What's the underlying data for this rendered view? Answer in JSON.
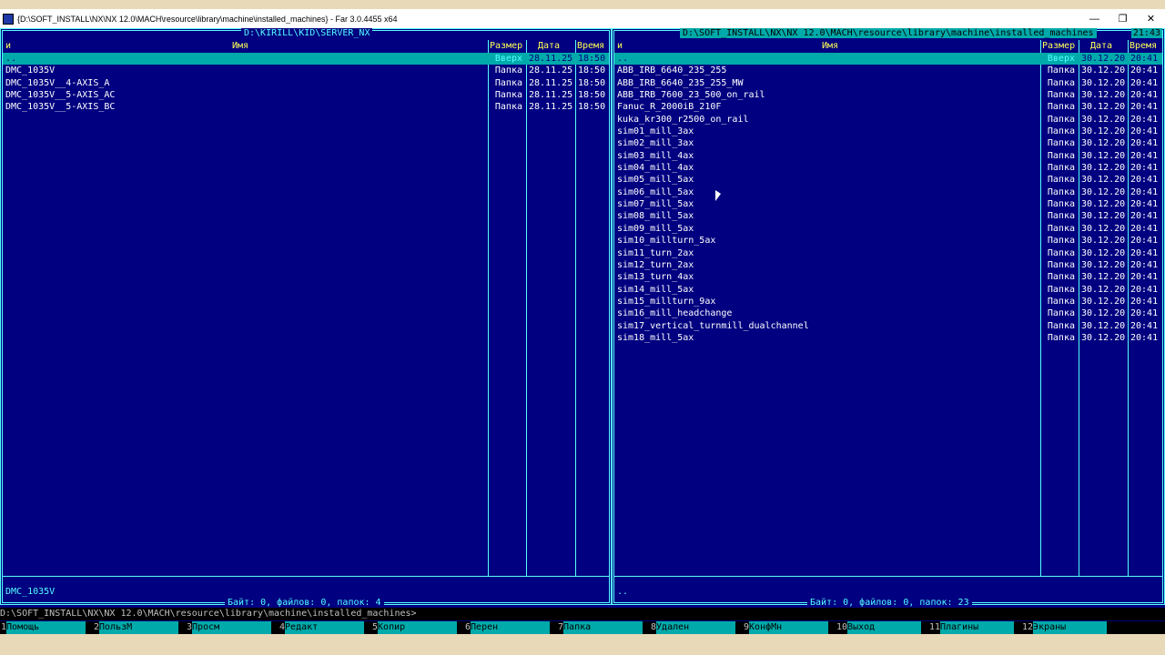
{
  "window": {
    "title": "{D:\\SOFT_INSTALL\\NX\\NX 12.0\\MACH\\resource\\library\\machine\\installed_machines} - Far 3.0.4455 x64",
    "minimize_glyph": "—",
    "maximize_glyph": "❐",
    "close_glyph": "✕"
  },
  "clock": "21:43",
  "left_panel": {
    "path": "D:\\KIRILL\\KID\\SERVER_NX",
    "headers": {
      "marker": "и",
      "name": "Имя",
      "size": "Размер",
      "date": "Дата",
      "time": "Время"
    },
    "rows": [
      {
        "name": "..",
        "size": "Вверх",
        "date": "28.11.25",
        "time": "18:50"
      },
      {
        "name": "DMC_1035V",
        "size": "Папка",
        "date": "28.11.25",
        "time": "18:50"
      },
      {
        "name": "DMC_1035V__4-AXIS_A",
        "size": "Папка",
        "date": "28.11.25",
        "time": "18:50"
      },
      {
        "name": "DMC_1035V__5-AXIS_AC",
        "size": "Папка",
        "date": "28.11.25",
        "time": "18:50"
      },
      {
        "name": "DMC_1035V__5-AXIS_BC",
        "size": "Папка",
        "date": "28.11.25",
        "time": "18:50"
      }
    ],
    "current_item": "DMC_1035V",
    "status": "Байт: 0, файлов: 0, папок: 4"
  },
  "right_panel": {
    "path": "D:\\SOFT_INSTALL\\NX\\NX 12.0\\MACH\\resource\\library\\machine\\installed_machines",
    "headers": {
      "marker": "и",
      "name": "Имя",
      "size": "Размер",
      "date": "Дата",
      "time": "Время"
    },
    "rows": [
      {
        "name": "..",
        "size": "Вверх",
        "date": "30.12.20",
        "time": "20:41"
      },
      {
        "name": "ABB_IRB_6640_235_255",
        "size": "Папка",
        "date": "30.12.20",
        "time": "20:41"
      },
      {
        "name": "ABB_IRB_6640_235_255_MW",
        "size": "Папка",
        "date": "30.12.20",
        "time": "20:41"
      },
      {
        "name": "ABB_IRB_7600_23_500_on_rail",
        "size": "Папка",
        "date": "30.12.20",
        "time": "20:41"
      },
      {
        "name": "Fanuc_R_2000iB_210F",
        "size": "Папка",
        "date": "30.12.20",
        "time": "20:41"
      },
      {
        "name": "kuka_kr300_r2500_on_rail",
        "size": "Папка",
        "date": "30.12.20",
        "time": "20:41"
      },
      {
        "name": "sim01_mill_3ax",
        "size": "Папка",
        "date": "30.12.20",
        "time": "20:41"
      },
      {
        "name": "sim02_mill_3ax",
        "size": "Папка",
        "date": "30.12.20",
        "time": "20:41"
      },
      {
        "name": "sim03_mill_4ax",
        "size": "Папка",
        "date": "30.12.20",
        "time": "20:41"
      },
      {
        "name": "sim04_mill_4ax",
        "size": "Папка",
        "date": "30.12.20",
        "time": "20:41"
      },
      {
        "name": "sim05_mill_5ax",
        "size": "Папка",
        "date": "30.12.20",
        "time": "20:41"
      },
      {
        "name": "sim06_mill_5ax",
        "size": "Папка",
        "date": "30.12.20",
        "time": "20:41"
      },
      {
        "name": "sim07_mill_5ax",
        "size": "Папка",
        "date": "30.12.20",
        "time": "20:41"
      },
      {
        "name": "sim08_mill_5ax",
        "size": "Папка",
        "date": "30.12.20",
        "time": "20:41"
      },
      {
        "name": "sim09_mill_5ax",
        "size": "Папка",
        "date": "30.12.20",
        "time": "20:41"
      },
      {
        "name": "sim10_millturn_5ax",
        "size": "Папка",
        "date": "30.12.20",
        "time": "20:41"
      },
      {
        "name": "sim11_turn_2ax",
        "size": "Папка",
        "date": "30.12.20",
        "time": "20:41"
      },
      {
        "name": "sim12_turn_2ax",
        "size": "Папка",
        "date": "30.12.20",
        "time": "20:41"
      },
      {
        "name": "sim13_turn_4ax",
        "size": "Папка",
        "date": "30.12.20",
        "time": "20:41"
      },
      {
        "name": "sim14_mill_5ax",
        "size": "Папка",
        "date": "30.12.20",
        "time": "20:41"
      },
      {
        "name": "sim15_millturn_9ax",
        "size": "Папка",
        "date": "30.12.20",
        "time": "20:41"
      },
      {
        "name": "sim16_mill_headchange",
        "size": "Папка",
        "date": "30.12.20",
        "time": "20:41"
      },
      {
        "name": "sim17_vertical_turnmill_dualchannel",
        "size": "Папка",
        "date": "30.12.20",
        "time": "20:41"
      },
      {
        "name": "sim18_mill_5ax",
        "size": "Папка",
        "date": "30.12.20",
        "time": "20:41"
      }
    ],
    "current_item": "..",
    "status": "Байт: 0, файлов: 0, папок: 23"
  },
  "command_line": "D:\\SOFT_INSTALL\\NX\\NX 12.0\\MACH\\resource\\library\\machine\\installed_machines>",
  "keybar": [
    {
      "num": "1",
      "label": "Помощь"
    },
    {
      "num": "2",
      "label": "ПользМ"
    },
    {
      "num": "3",
      "label": "Просм"
    },
    {
      "num": "4",
      "label": "Редакт"
    },
    {
      "num": "5",
      "label": "Копир"
    },
    {
      "num": "6",
      "label": "Перен"
    },
    {
      "num": "7",
      "label": "Папка"
    },
    {
      "num": "8",
      "label": "Удален"
    },
    {
      "num": "9",
      "label": "КонфМн"
    },
    {
      "num": "10",
      "label": "Выход"
    },
    {
      "num": "11",
      "label": "Плагины"
    },
    {
      "num": "12",
      "label": "Экраны"
    }
  ],
  "colors": {
    "panel_bg": "#000080",
    "frame": "#55ffff",
    "header_text": "#ffff55",
    "selection_bg": "#00aaaa"
  }
}
